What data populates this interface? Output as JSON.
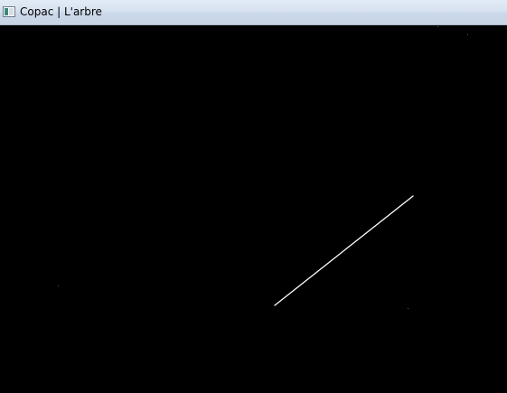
{
  "window": {
    "title": "Copac | L'arbre",
    "icon": "application-window-icon"
  },
  "canvas": {
    "background": "#000000",
    "stroke_color": "#ffffff",
    "dot_color": "#5a5a5a"
  }
}
